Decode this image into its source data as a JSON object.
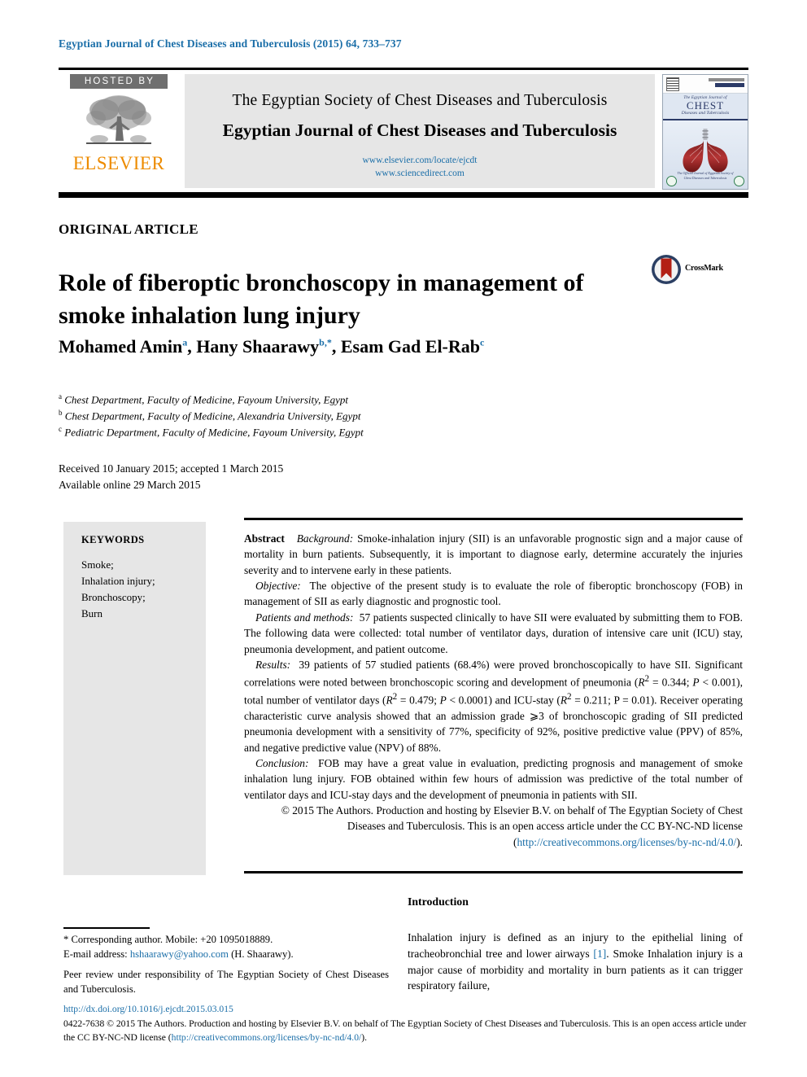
{
  "running_head": "Egyptian Journal of Chest Diseases and Tuberculosis (2015) 64, 733–737",
  "header": {
    "hosted_by": "HOSTED BY",
    "publisher": "ELSEVIER",
    "society_line": "The Egyptian Society of Chest Diseases and Tuberculosis",
    "journal_line": "Egyptian Journal of Chest Diseases and Tuberculosis",
    "url_1": "www.elsevier.com/locate/ejcdt",
    "url_2": "www.sciencedirect.com",
    "cover": {
      "top_line": "The Egyptian Journal of",
      "main_word": "CHEST",
      "sub_line": "Diseases and Tuberculosis",
      "footer_line": "The Official Journal of Egyptian Society of Chest Diseases and Tuberculosis"
    }
  },
  "article": {
    "type": "ORIGINAL ARTICLE",
    "title": "Role of fiberoptic bronchoscopy in management of smoke inhalation lung injury",
    "crossmark_label": "CrossMark",
    "authors": [
      {
        "name": "Mohamed Amin",
        "marker": "a"
      },
      {
        "name": "Hany Shaarawy",
        "marker": "b,*"
      },
      {
        "name": "Esam Gad El-Rab",
        "marker": "c"
      }
    ],
    "affiliations": [
      {
        "marker": "a",
        "text": "Chest Department, Faculty of Medicine, Fayoum University, Egypt"
      },
      {
        "marker": "b",
        "text": "Chest Department, Faculty of Medicine, Alexandria University, Egypt"
      },
      {
        "marker": "c",
        "text": "Pediatric Department, Faculty of Medicine, Fayoum University, Egypt"
      }
    ],
    "history_received": "Received 10 January 2015; accepted 1 March 2015",
    "history_online": "Available online 29 March 2015"
  },
  "keywords": {
    "heading": "KEYWORDS",
    "items": [
      "Smoke;",
      "Inhalation injury;",
      "Bronchoscopy;",
      "Burn"
    ]
  },
  "abstract": {
    "label": "Abstract",
    "background_label": "Background:",
    "background_text": "Smoke-inhalation injury (SII) is an unfavorable prognostic sign and a major cause of mortality in burn patients. Subsequently, it is important to diagnose early, determine accurately the injuries severity and to intervene early in these patients.",
    "objective_label": "Objective:",
    "objective_text": "The objective of the present study is to evaluate the role of fiberoptic bronchoscopy (FOB) in management of SII as early diagnostic and prognostic tool.",
    "methods_label": "Patients and methods:",
    "methods_text": "57 patients suspected clinically to have SII were evaluated by submitting them to FOB. The following data were collected: total number of ventilator days, duration of intensive care unit (ICU) stay, pneumonia development, and patient outcome.",
    "results_label": "Results:",
    "results_text_1": "39 patients of 57 studied patients (68.4%) were proved bronchoscopically to have SII. Significant correlations were noted between bronchoscopic scoring and development of pneumonia (",
    "results_r2a": "R",
    "results_sup": "2",
    "results_text_2": " = 0.344; ",
    "results_p1": "P",
    "results_text_3": " < 0.001), total number of ventilator days (",
    "results_text_4": " = 0.479; ",
    "results_text_5": " < 0.0001) and ICU-stay (",
    "results_text_6": " = 0.211; P = 0.01). Receiver operating characteristic curve analysis showed that an admission grade ⩾3 of bronchoscopic grading of SII predicted pneumonia development with a sensitivity of 77%, specificity of 92%, positive predictive value (PPV) of 85%, and negative predictive value (NPV) of 88%.",
    "conclusion_label": "Conclusion:",
    "conclusion_text": "FOB may have a great value in evaluation, predicting prognosis and management of smoke inhalation lung injury. FOB obtained within few hours of admission was predictive of the total number of ventilator days and ICU-stay days and the development of pneumonia in patients with SII.",
    "copyright_text": "© 2015 The Authors. Production and hosting by Elsevier B.V. on behalf of The Egyptian Society of Chest Diseases and Tuberculosis. This is an open access article under the CC BY-NC-ND license (",
    "copyright_link": "http://creativecommons.org/licenses/by-nc-nd/4.0/",
    "copyright_tail": ")."
  },
  "footnotes": {
    "corresponding": "* Corresponding author. Mobile: +20 1095018889.",
    "email_label": "E-mail address:",
    "email": "hshaarawy@yahoo.com",
    "email_tail": "(H. Shaarawy).",
    "peer_review": "Peer review under responsibility of The Egyptian Society of Chest Diseases and Tuberculosis."
  },
  "footer": {
    "doi": "http://dx.doi.org/10.1016/j.ejcdt.2015.03.015",
    "issn_line": "0422-7638 © 2015 The Authors. Production and hosting by Elsevier B.V. on behalf of The Egyptian Society of Chest Diseases and Tuberculosis.",
    "license_prefix": "This is an open access article under the CC BY-NC-ND license (",
    "license_link": "http://creativecommons.org/licenses/by-nc-nd/4.0/",
    "license_tail": ")."
  },
  "introduction": {
    "heading": "Introduction",
    "text_1": "Inhalation injury is defined as an injury to the epithelial lining of tracheobronchial tree and lower airways ",
    "reference": "[1]",
    "text_2": ". Smoke Inhalation injury is a major cause of morbidity and mortality in burn patients as it can trigger respiratory failure,"
  },
  "colors": {
    "link": "#1a6ea8",
    "elsevier_orange": "#ed8b00",
    "panel_gray": "#e6e6e6",
    "hosted_gray": "#6f6f6f"
  }
}
